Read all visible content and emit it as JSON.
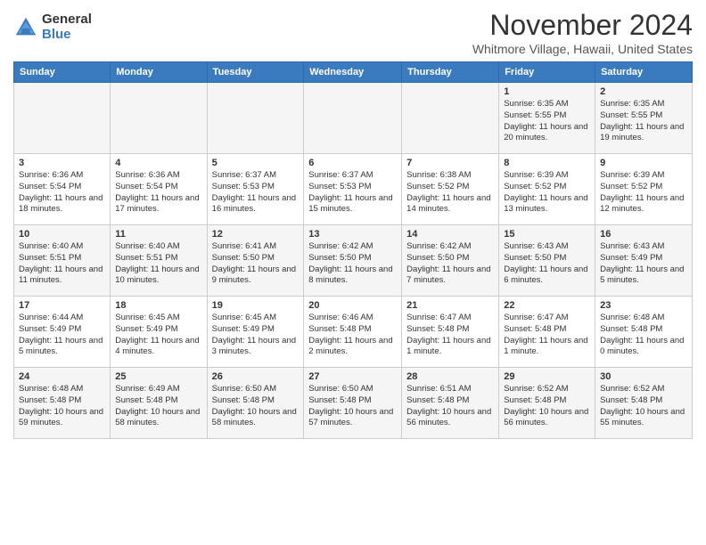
{
  "header": {
    "logo_general": "General",
    "logo_blue": "Blue",
    "month_title": "November 2024",
    "location": "Whitmore Village, Hawaii, United States"
  },
  "days_of_week": [
    "Sunday",
    "Monday",
    "Tuesday",
    "Wednesday",
    "Thursday",
    "Friday",
    "Saturday"
  ],
  "weeks": [
    [
      {
        "day": "",
        "info": ""
      },
      {
        "day": "",
        "info": ""
      },
      {
        "day": "",
        "info": ""
      },
      {
        "day": "",
        "info": ""
      },
      {
        "day": "",
        "info": ""
      },
      {
        "day": "1",
        "info": "Sunrise: 6:35 AM\nSunset: 5:55 PM\nDaylight: 11 hours and 20 minutes."
      },
      {
        "day": "2",
        "info": "Sunrise: 6:35 AM\nSunset: 5:55 PM\nDaylight: 11 hours and 19 minutes."
      }
    ],
    [
      {
        "day": "3",
        "info": "Sunrise: 6:36 AM\nSunset: 5:54 PM\nDaylight: 11 hours and 18 minutes."
      },
      {
        "day": "4",
        "info": "Sunrise: 6:36 AM\nSunset: 5:54 PM\nDaylight: 11 hours and 17 minutes."
      },
      {
        "day": "5",
        "info": "Sunrise: 6:37 AM\nSunset: 5:53 PM\nDaylight: 11 hours and 16 minutes."
      },
      {
        "day": "6",
        "info": "Sunrise: 6:37 AM\nSunset: 5:53 PM\nDaylight: 11 hours and 15 minutes."
      },
      {
        "day": "7",
        "info": "Sunrise: 6:38 AM\nSunset: 5:52 PM\nDaylight: 11 hours and 14 minutes."
      },
      {
        "day": "8",
        "info": "Sunrise: 6:39 AM\nSunset: 5:52 PM\nDaylight: 11 hours and 13 minutes."
      },
      {
        "day": "9",
        "info": "Sunrise: 6:39 AM\nSunset: 5:52 PM\nDaylight: 11 hours and 12 minutes."
      }
    ],
    [
      {
        "day": "10",
        "info": "Sunrise: 6:40 AM\nSunset: 5:51 PM\nDaylight: 11 hours and 11 minutes."
      },
      {
        "day": "11",
        "info": "Sunrise: 6:40 AM\nSunset: 5:51 PM\nDaylight: 11 hours and 10 minutes."
      },
      {
        "day": "12",
        "info": "Sunrise: 6:41 AM\nSunset: 5:50 PM\nDaylight: 11 hours and 9 minutes."
      },
      {
        "day": "13",
        "info": "Sunrise: 6:42 AM\nSunset: 5:50 PM\nDaylight: 11 hours and 8 minutes."
      },
      {
        "day": "14",
        "info": "Sunrise: 6:42 AM\nSunset: 5:50 PM\nDaylight: 11 hours and 7 minutes."
      },
      {
        "day": "15",
        "info": "Sunrise: 6:43 AM\nSunset: 5:50 PM\nDaylight: 11 hours and 6 minutes."
      },
      {
        "day": "16",
        "info": "Sunrise: 6:43 AM\nSunset: 5:49 PM\nDaylight: 11 hours and 5 minutes."
      }
    ],
    [
      {
        "day": "17",
        "info": "Sunrise: 6:44 AM\nSunset: 5:49 PM\nDaylight: 11 hours and 5 minutes."
      },
      {
        "day": "18",
        "info": "Sunrise: 6:45 AM\nSunset: 5:49 PM\nDaylight: 11 hours and 4 minutes."
      },
      {
        "day": "19",
        "info": "Sunrise: 6:45 AM\nSunset: 5:49 PM\nDaylight: 11 hours and 3 minutes."
      },
      {
        "day": "20",
        "info": "Sunrise: 6:46 AM\nSunset: 5:48 PM\nDaylight: 11 hours and 2 minutes."
      },
      {
        "day": "21",
        "info": "Sunrise: 6:47 AM\nSunset: 5:48 PM\nDaylight: 11 hours and 1 minute."
      },
      {
        "day": "22",
        "info": "Sunrise: 6:47 AM\nSunset: 5:48 PM\nDaylight: 11 hours and 1 minute."
      },
      {
        "day": "23",
        "info": "Sunrise: 6:48 AM\nSunset: 5:48 PM\nDaylight: 11 hours and 0 minutes."
      }
    ],
    [
      {
        "day": "24",
        "info": "Sunrise: 6:48 AM\nSunset: 5:48 PM\nDaylight: 10 hours and 59 minutes."
      },
      {
        "day": "25",
        "info": "Sunrise: 6:49 AM\nSunset: 5:48 PM\nDaylight: 10 hours and 58 minutes."
      },
      {
        "day": "26",
        "info": "Sunrise: 6:50 AM\nSunset: 5:48 PM\nDaylight: 10 hours and 58 minutes."
      },
      {
        "day": "27",
        "info": "Sunrise: 6:50 AM\nSunset: 5:48 PM\nDaylight: 10 hours and 57 minutes."
      },
      {
        "day": "28",
        "info": "Sunrise: 6:51 AM\nSunset: 5:48 PM\nDaylight: 10 hours and 56 minutes."
      },
      {
        "day": "29",
        "info": "Sunrise: 6:52 AM\nSunset: 5:48 PM\nDaylight: 10 hours and 56 minutes."
      },
      {
        "day": "30",
        "info": "Sunrise: 6:52 AM\nSunset: 5:48 PM\nDaylight: 10 hours and 55 minutes."
      }
    ]
  ]
}
